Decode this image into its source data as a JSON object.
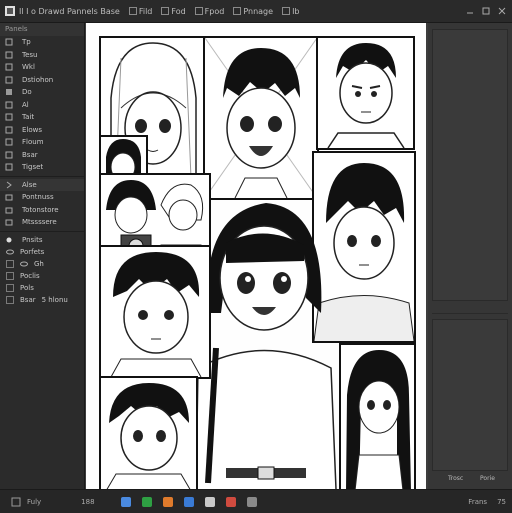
{
  "menu": {
    "title": "Il  I o Drawd  Pannels  Base",
    "items": [
      "Fild",
      "Fod",
      "Fpod",
      "Pnnage"
    ],
    "extra": "Ib"
  },
  "sidebar": {
    "header": "Panels",
    "items": [
      "Tp",
      "Tesu",
      "Wkl",
      "Dstiohon",
      "Do",
      "Al",
      "Tait",
      "Elows",
      "Floum",
      "Bsar",
      "Tigset"
    ],
    "sections": [
      "Alse",
      "Pontnuss",
      "Totonstore",
      "Mtssssere"
    ],
    "layers_header": "Pnsits",
    "layers": [
      "Porfets",
      "Gh",
      "Poclis",
      "Pols",
      "Bsar"
    ],
    "layer_note": "5 hlonu"
  },
  "right_panel": {
    "labels": [
      "Trosc",
      "Porie"
    ]
  },
  "status": {
    "zoom": "Fuly",
    "page": "188",
    "coords": "Frans",
    "extra": "75"
  },
  "colors": {
    "app_bg": "#3c3c3c",
    "panel_bg": "#2b2b2b",
    "accent": "#3a7bd5"
  },
  "icons": [
    "pen-icon",
    "brush-icon",
    "eraser-icon",
    "select-icon",
    "fill-icon",
    "text-icon",
    "layer-icon",
    "eye-icon",
    "lock-icon"
  ]
}
